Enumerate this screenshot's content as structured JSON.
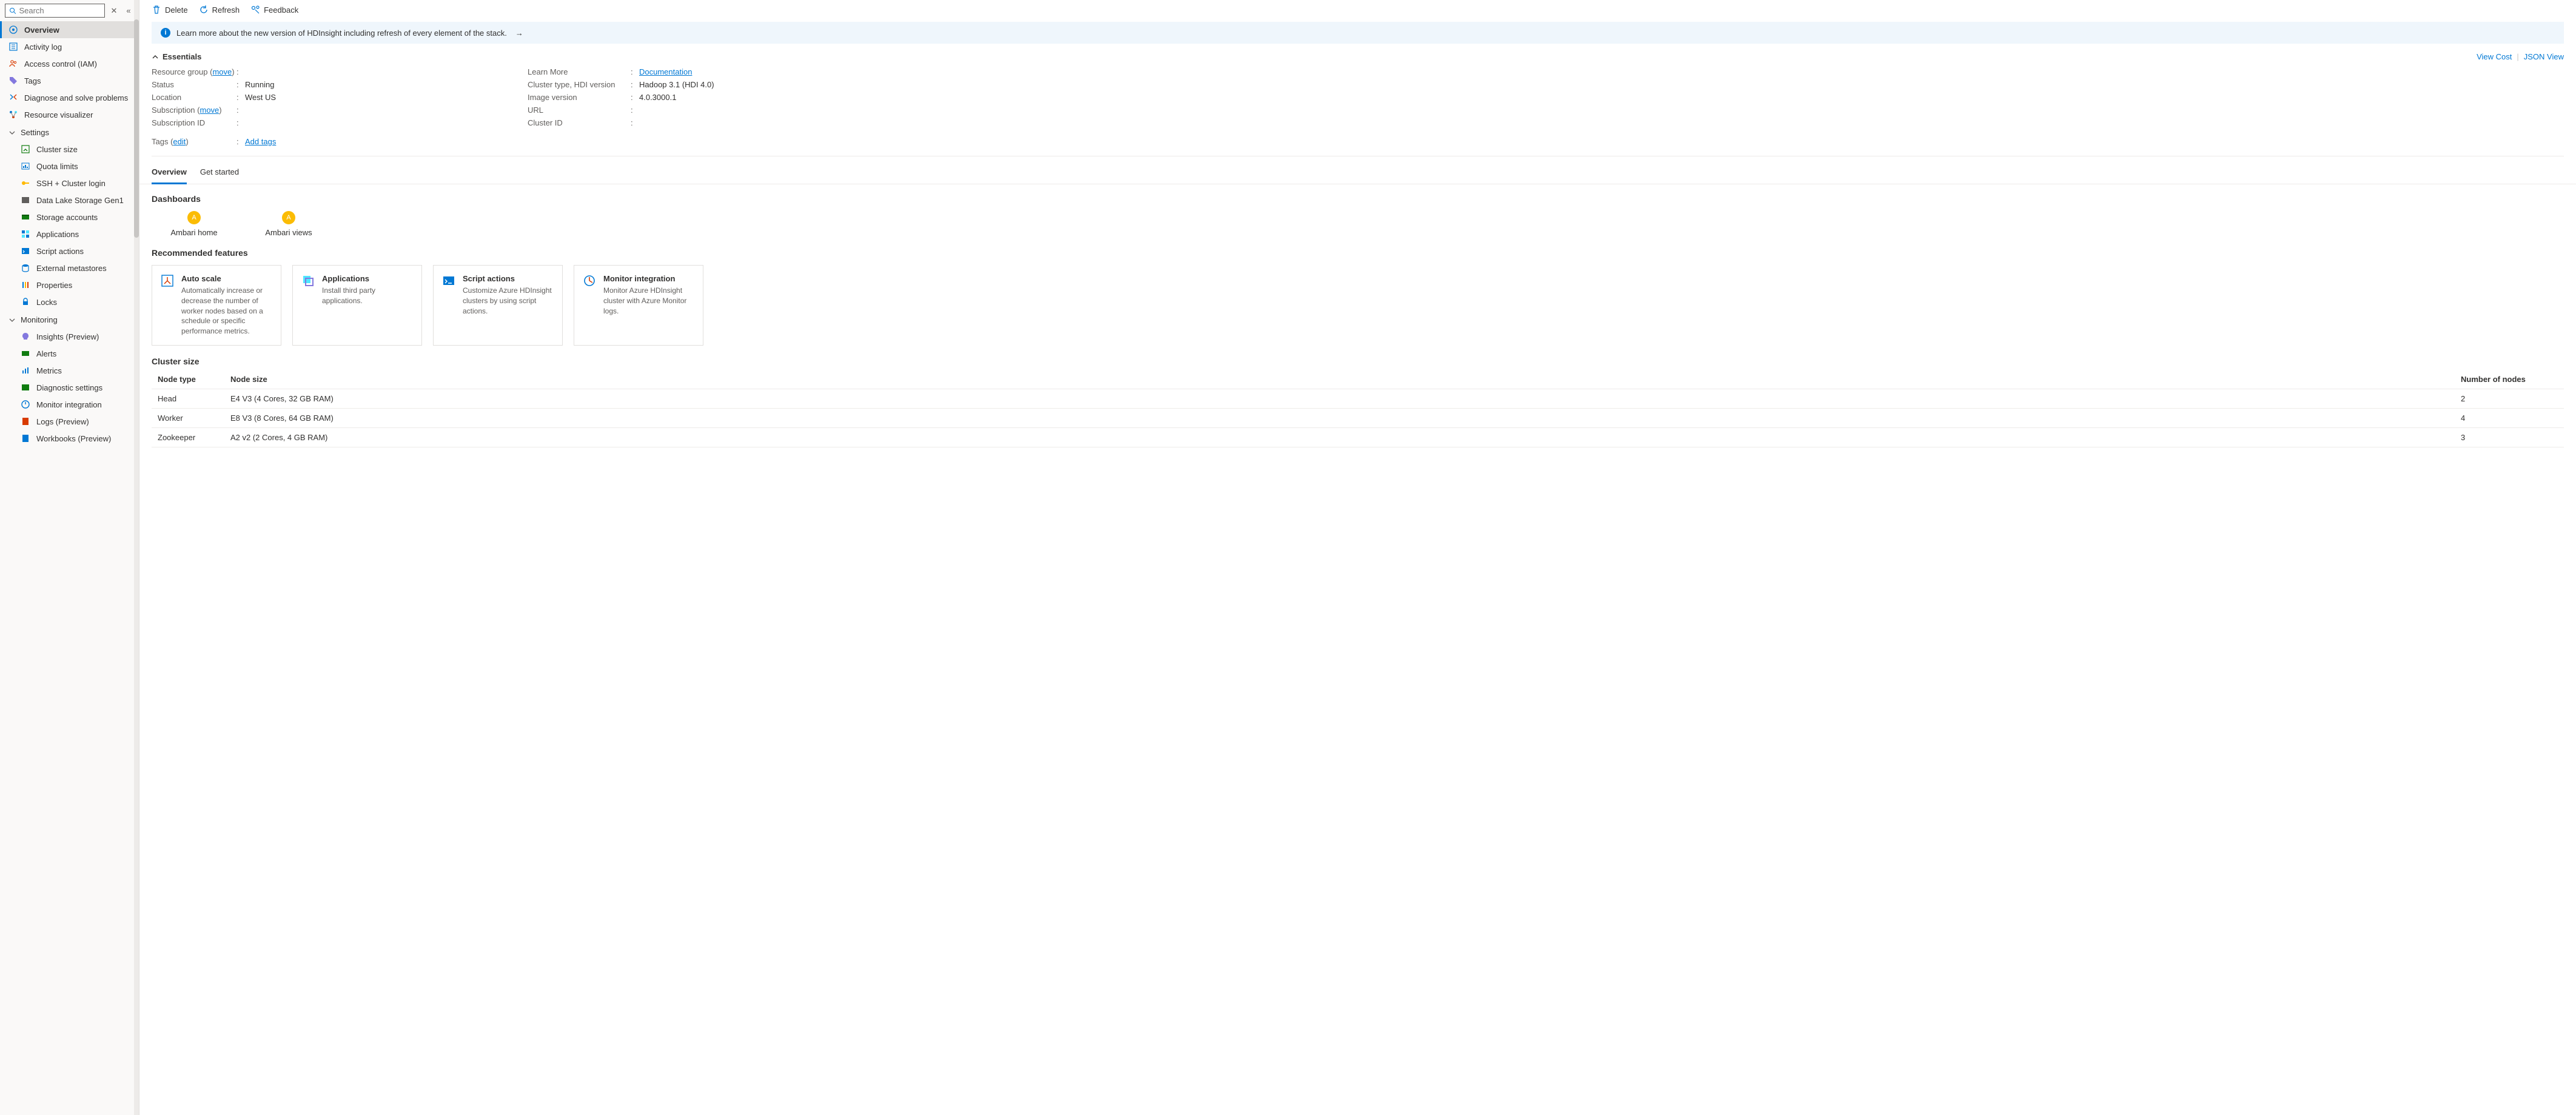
{
  "search": {
    "placeholder": "Search"
  },
  "sidebar": {
    "items": [
      {
        "label": "Overview"
      },
      {
        "label": "Activity log"
      },
      {
        "label": "Access control (IAM)"
      },
      {
        "label": "Tags"
      },
      {
        "label": "Diagnose and solve problems"
      },
      {
        "label": "Resource visualizer"
      }
    ],
    "settings_label": "Settings",
    "settings": [
      {
        "label": "Cluster size"
      },
      {
        "label": "Quota limits"
      },
      {
        "label": "SSH + Cluster login"
      },
      {
        "label": "Data Lake Storage Gen1"
      },
      {
        "label": "Storage accounts"
      },
      {
        "label": "Applications"
      },
      {
        "label": "Script actions"
      },
      {
        "label": "External metastores"
      },
      {
        "label": "Properties"
      },
      {
        "label": "Locks"
      }
    ],
    "monitoring_label": "Monitoring",
    "monitoring": [
      {
        "label": "Insights (Preview)"
      },
      {
        "label": "Alerts"
      },
      {
        "label": "Metrics"
      },
      {
        "label": "Diagnostic settings"
      },
      {
        "label": "Monitor integration"
      },
      {
        "label": "Logs (Preview)"
      },
      {
        "label": "Workbooks (Preview)"
      }
    ]
  },
  "toolbar": {
    "delete": "Delete",
    "refresh": "Refresh",
    "feedback": "Feedback"
  },
  "info_banner": "Learn more about the new version of HDInsight including refresh of every element of the stack.",
  "essentials": {
    "title": "Essentials",
    "view_cost": "View Cost",
    "json_view": "JSON View",
    "left": {
      "resource_group_label": "Resource group",
      "resource_group_move": "move",
      "status_label": "Status",
      "status_value": "Running",
      "location_label": "Location",
      "location_value": "West US",
      "subscription_label": "Subscription",
      "subscription_move": "move",
      "subscription_id_label": "Subscription ID",
      "tags_label": "Tags",
      "tags_edit": "edit",
      "add_tags": "Add tags"
    },
    "right": {
      "learn_more_label": "Learn More",
      "learn_more_value": "Documentation",
      "cluster_type_label": "Cluster type, HDI version",
      "cluster_type_value": "Hadoop 3.1 (HDI 4.0)",
      "image_version_label": "Image version",
      "image_version_value": "4.0.3000.1",
      "url_label": "URL",
      "cluster_id_label": "Cluster ID"
    }
  },
  "tabs": {
    "overview": "Overview",
    "get_started": "Get started"
  },
  "dashboards": {
    "title": "Dashboards",
    "ambari_home": "Ambari home",
    "ambari_views": "Ambari views"
  },
  "features": {
    "title": "Recommended features",
    "cards": [
      {
        "title": "Auto scale",
        "desc": "Automatically increase or decrease the number of worker nodes based on a schedule or specific performance metrics."
      },
      {
        "title": "Applications",
        "desc": "Install third party applications."
      },
      {
        "title": "Script actions",
        "desc": "Customize Azure HDInsight clusters by using script actions."
      },
      {
        "title": "Monitor integration",
        "desc": "Monitor Azure HDInsight cluster with Azure Monitor logs."
      }
    ]
  },
  "cluster_size": {
    "title": "Cluster size",
    "headers": {
      "node_type": "Node type",
      "node_size": "Node size",
      "num_nodes": "Number of nodes"
    },
    "rows": [
      {
        "type": "Head",
        "size": "E4 V3 (4 Cores, 32 GB RAM)",
        "nodes": "2"
      },
      {
        "type": "Worker",
        "size": "E8 V3 (8 Cores, 64 GB RAM)",
        "nodes": "4"
      },
      {
        "type": "Zookeeper",
        "size": "A2 v2 (2 Cores, 4 GB RAM)",
        "nodes": "3"
      }
    ]
  }
}
